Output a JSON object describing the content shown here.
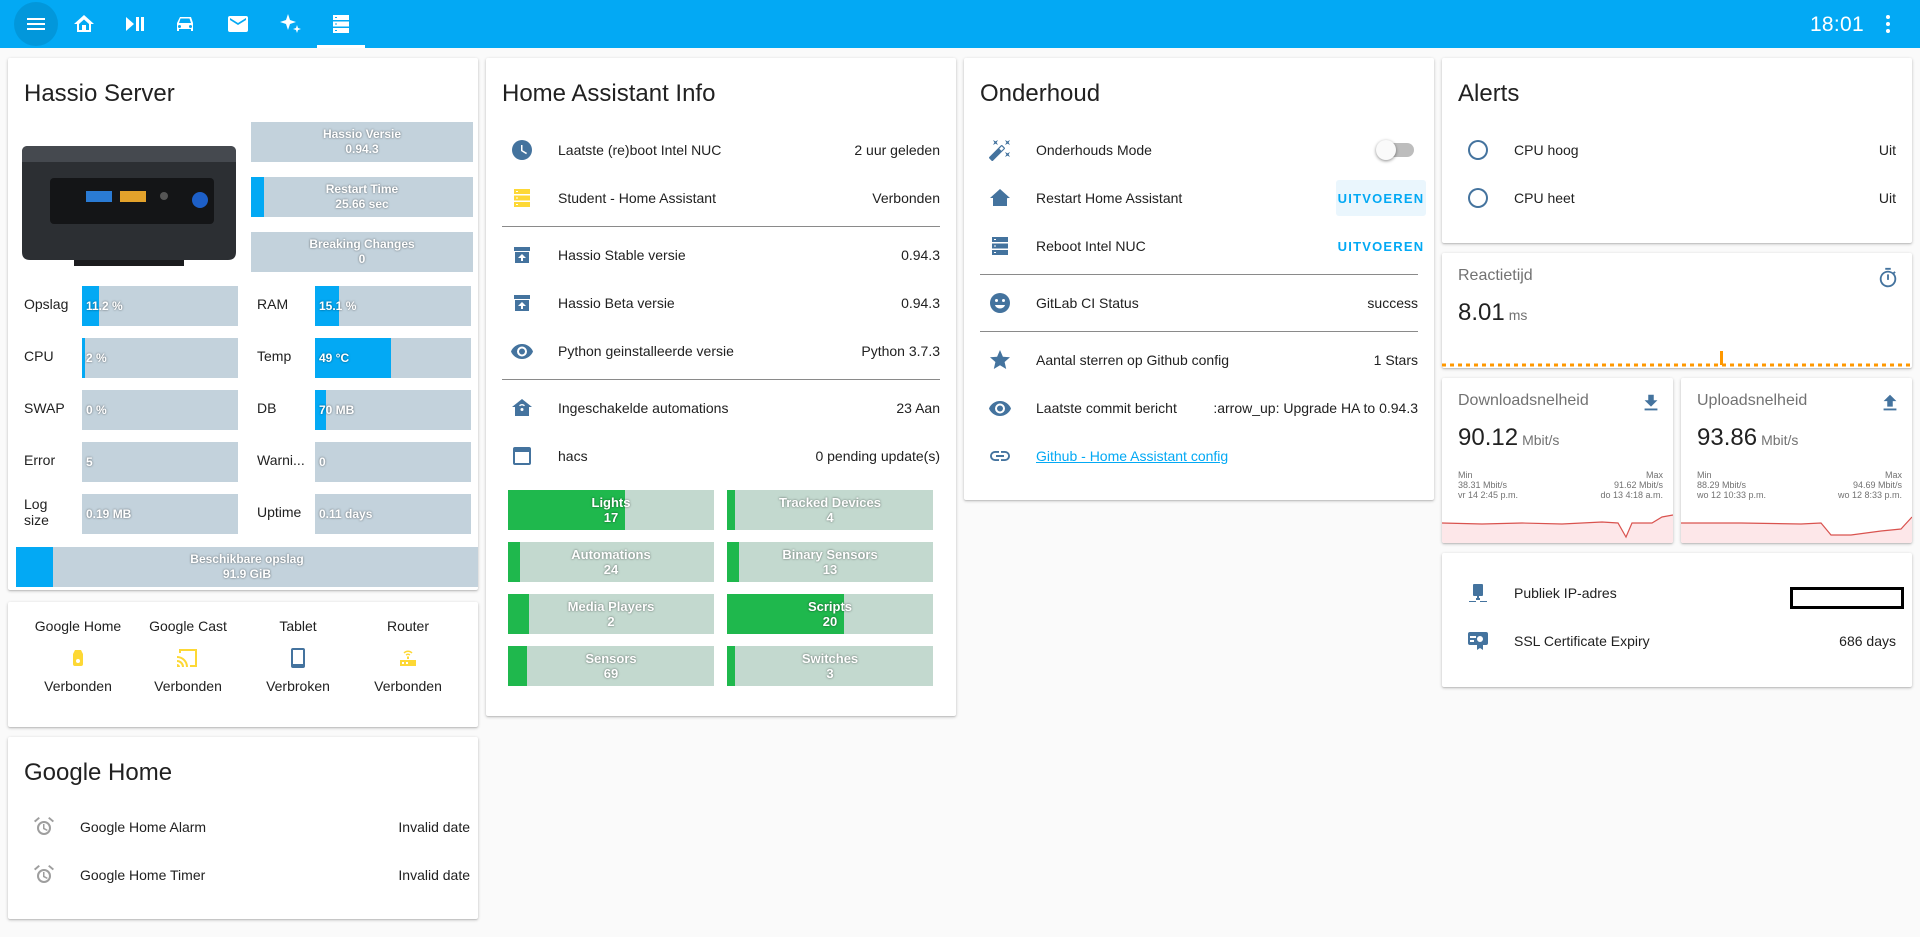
{
  "topbar": {
    "clock": "18:01",
    "accent": "#03a9f4"
  },
  "hassio": {
    "title": "Hassio Server",
    "version": {
      "label": "Hassio Versie",
      "value": "0.94.3"
    },
    "restart": {
      "label": "Restart Time",
      "value": "25.66 sec",
      "fill": 0.06
    },
    "breaking": {
      "label": "Breaking Changes",
      "value": "0"
    },
    "stats": [
      {
        "label": "Opslag",
        "value": "11.2 %",
        "fill": 0.112
      },
      {
        "label": "RAM",
        "value": "15.1 %",
        "fill": 0.151
      },
      {
        "label": "CPU",
        "value": "2 %",
        "fill": 0.02
      },
      {
        "label": "Temp",
        "value": "49 °C",
        "fill": 0.49
      },
      {
        "label": "SWAP",
        "value": "0 %",
        "fill": 0
      },
      {
        "label": "DB",
        "value": "70 MB",
        "fill": 0.07
      },
      {
        "label": "Error",
        "value": "5",
        "fill": 0
      },
      {
        "label": "Warni...",
        "value": "0",
        "fill": 0
      },
      {
        "label": "Log size",
        "value": "0.19 MB",
        "fill": 0
      },
      {
        "label": "Uptime",
        "value": "0.11 days",
        "fill": 0
      }
    ],
    "storage": {
      "label": "Beschikbare opslag",
      "value": "91.9 GiB",
      "fill": 0.08
    }
  },
  "devices": [
    {
      "name": "Google Home",
      "state": "Verbonden",
      "icon": "speaker-icon"
    },
    {
      "name": "Google Cast",
      "state": "Verbonden",
      "icon": "cast-icon"
    },
    {
      "name": "Tablet",
      "state": "Verbroken",
      "icon": "tablet-icon"
    },
    {
      "name": "Router",
      "state": "Verbonden",
      "icon": "router-icon"
    }
  ],
  "google_home": {
    "title": "Google Home",
    "rows": [
      {
        "name": "Google Home Alarm",
        "value": "Invalid date"
      },
      {
        "name": "Google Home Timer",
        "value": "Invalid date"
      }
    ]
  },
  "info": {
    "title": "Home Assistant Info",
    "rows": [
      {
        "name": "Laatste (re)boot Intel NUC",
        "value": "2 uur geleden",
        "icon": "clock-icon"
      },
      {
        "name": "Student - Home Assistant",
        "value": "Verbonden",
        "icon": "server-icon"
      },
      {
        "name": "Hassio Stable versie",
        "value": "0.94.3",
        "icon": "package-up-icon"
      },
      {
        "name": "Hassio Beta versie",
        "value": "0.94.3",
        "icon": "package-up-icon"
      },
      {
        "name": "Python geinstalleerde versie",
        "value": "Python 3.7.3",
        "icon": "eye-icon"
      },
      {
        "name": "Ingeschakelde automations",
        "value": "23 Aan",
        "icon": "home-automation-icon"
      },
      {
        "name": "hacs",
        "value": "0 pending update(s)",
        "icon": "package-icon"
      }
    ],
    "counts": [
      {
        "label": "Lights",
        "value": "17",
        "fill": 0.57
      },
      {
        "label": "Tracked Devices",
        "value": "4",
        "fill": 0.04
      },
      {
        "label": "Automations",
        "value": "24",
        "fill": 0.06
      },
      {
        "label": "Binary Sensors",
        "value": "13",
        "fill": 0.06
      },
      {
        "label": "Media Players",
        "value": "2",
        "fill": 0.1
      },
      {
        "label": "Scripts",
        "value": "20",
        "fill": 0.57
      },
      {
        "label": "Sensors",
        "value": "69",
        "fill": 0.09
      },
      {
        "label": "Switches",
        "value": "3",
        "fill": 0.04
      }
    ]
  },
  "onderhoud": {
    "title": "Onderhoud",
    "rows": [
      {
        "name": "Onderhouds Mode",
        "icon": "magic-wand-icon"
      },
      {
        "name": "Restart Home Assistant",
        "action": "UITVOEREN",
        "icon": "home-restart-icon"
      },
      {
        "name": "Reboot Intel NUC",
        "action": "UITVOEREN",
        "icon": "server-icon"
      },
      {
        "name": "GitLab CI Status",
        "value": "success",
        "icon": "emoticon-icon"
      },
      {
        "name": "Aantal sterren op Github config",
        "value": "1 Stars",
        "icon": "star-icon"
      },
      {
        "name": "Laatste commit bericht",
        "value": ":arrow_up: Upgrade HA to 0.94.3",
        "icon": "eye-icon"
      },
      {
        "name": "Github - Home Assistant config",
        "icon": "link-icon"
      }
    ]
  },
  "alerts": {
    "title": "Alerts",
    "rows": [
      {
        "name": "CPU hoog",
        "value": "Uit"
      },
      {
        "name": "CPU heet",
        "value": "Uit"
      }
    ]
  },
  "reactie": {
    "name": "Reactietijd",
    "value": "8.01",
    "unit": "ms",
    "line_color": "#ff9800"
  },
  "download": {
    "name": "Downloadsnelheid",
    "value": "90.12",
    "unit": "Mbit/s",
    "min_label": "Min",
    "min_value": "38.31 Mbit/s",
    "min_time": "vr 14 2:45 p.m.",
    "max_label": "Max",
    "max_value": "91.62 Mbit/s",
    "max_time": "do 13 4:18 a.m."
  },
  "upload": {
    "name": "Uploadsnelheid",
    "value": "93.86",
    "unit": "Mbit/s",
    "min_label": "Min",
    "min_value": "88.29 Mbit/s",
    "min_time": "wo 12 10:33 p.m.",
    "max_label": "Max",
    "max_value": "94.69 Mbit/s",
    "max_time": "wo 12 8:33 p.m."
  },
  "network": {
    "rows": [
      {
        "name": "Publiek IP-adres",
        "value": ""
      },
      {
        "name": "SSL Certificate Expiry",
        "value": "686 days"
      }
    ]
  }
}
